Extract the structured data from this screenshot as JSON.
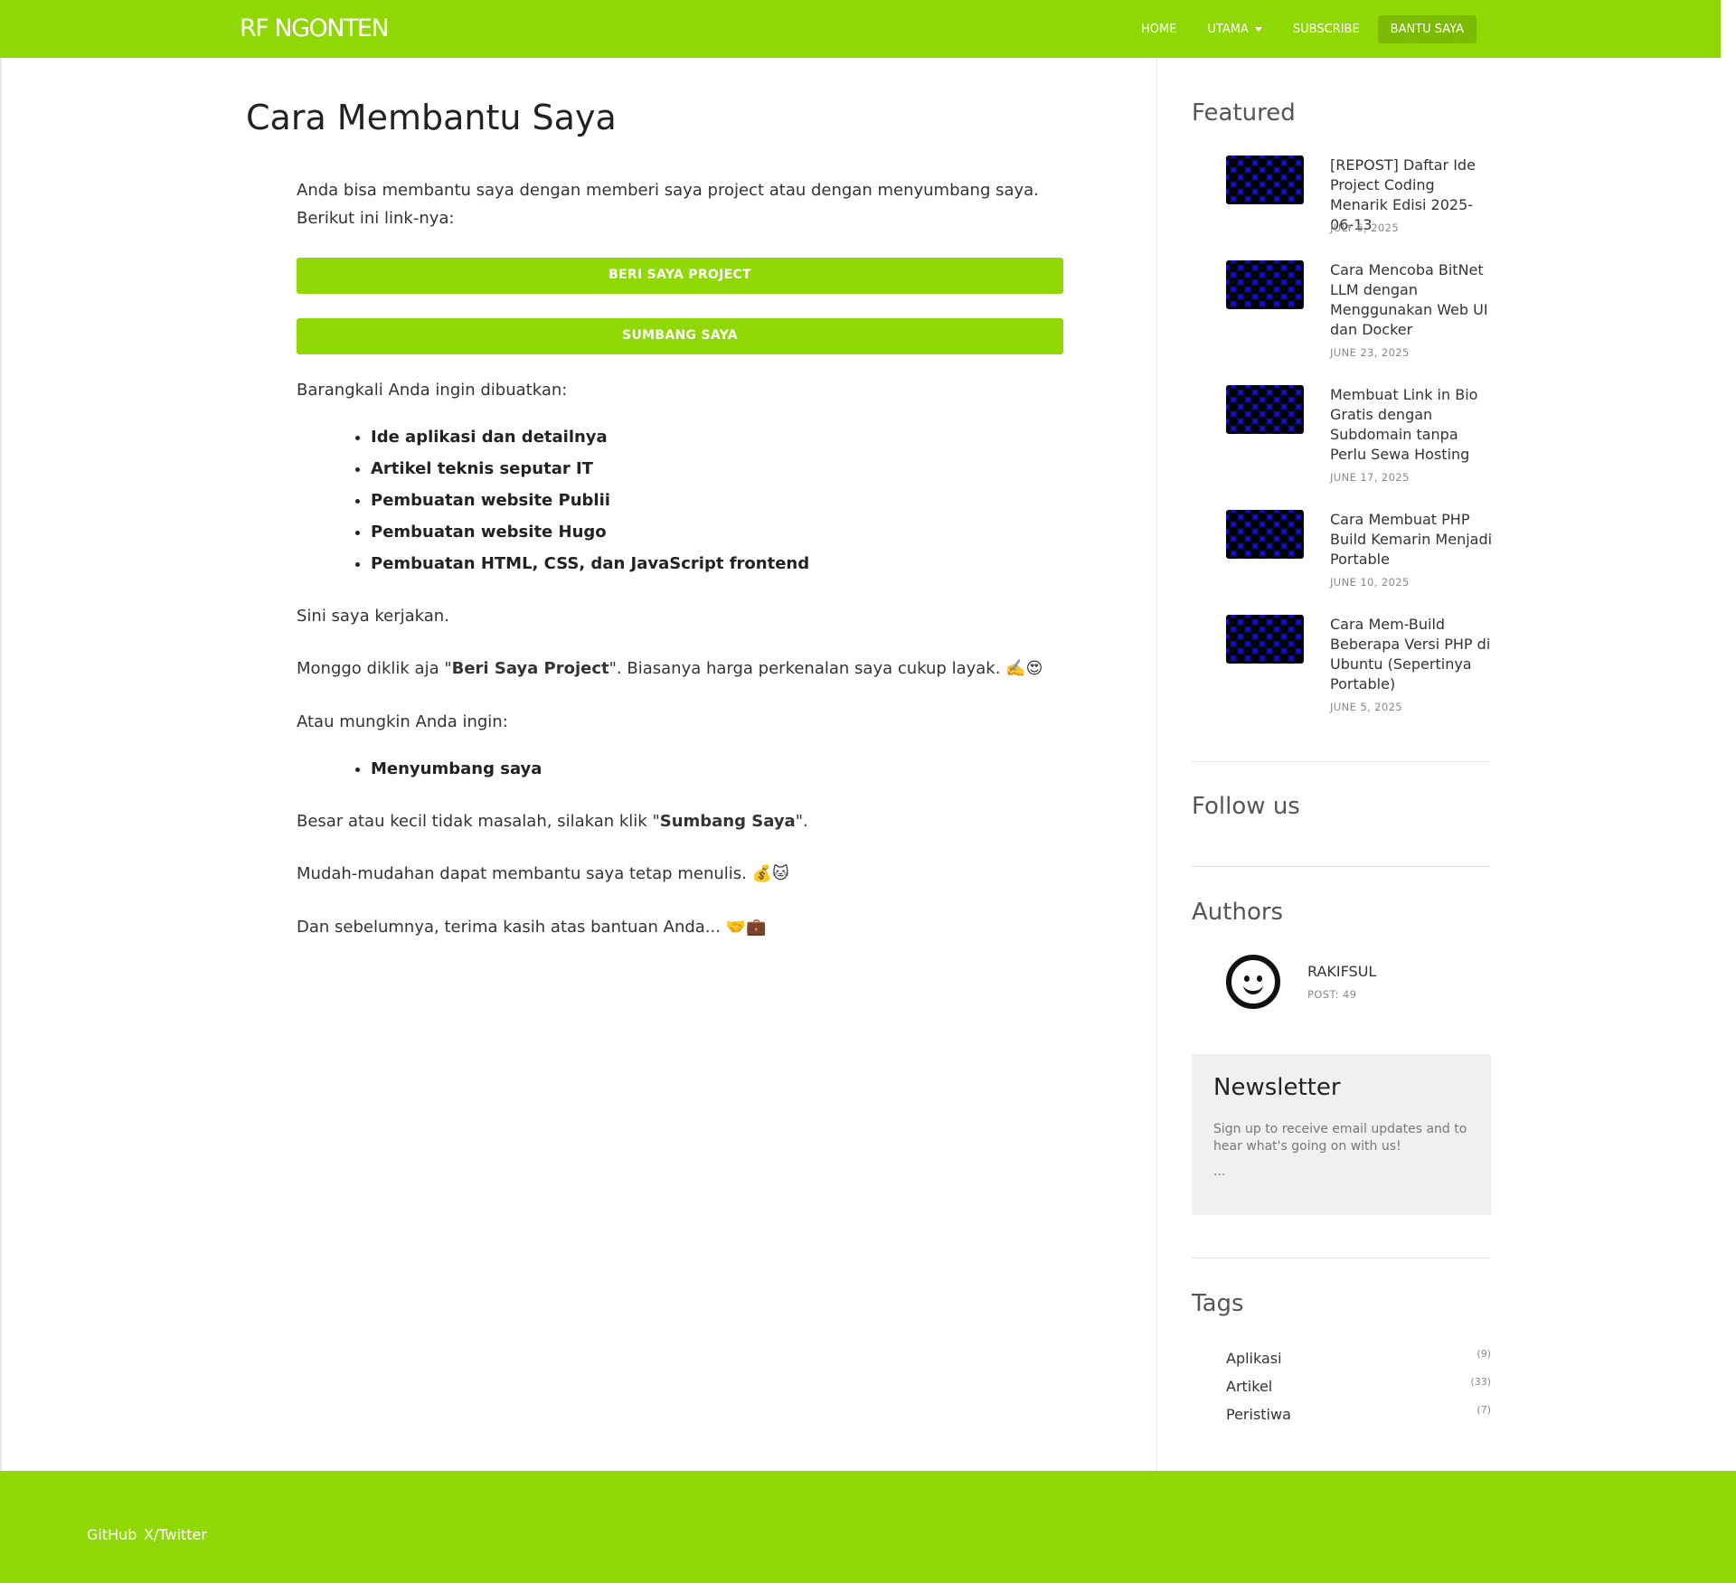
{
  "header": {
    "logo": "RF NGONTEN",
    "nav": {
      "home": "HOME",
      "utama": "UTAMA",
      "subscribe": "SUBSCRIBE",
      "bantu": "BANTU SAYA"
    }
  },
  "main": {
    "title": "Cara Membantu Saya",
    "intro": "Anda bisa membantu saya dengan memberi saya project atau dengan menyumbang saya. Berikut ini link-nya:",
    "button_project": "BERI SAYA PROJECT",
    "button_donate": "SUMBANG SAYA",
    "maybe_text": "Barangkali Anda ingin dibuatkan:",
    "services": [
      "Ide aplikasi dan detailnya",
      "Artikel teknis seputar IT",
      "Pembuatan website Publii",
      "Pembuatan website Hugo",
      "Pembuatan HTML, CSS, dan JavaScript frontend"
    ],
    "do_it": "Sini saya kerjakan.",
    "click_pre": "Monggo diklik aja \"",
    "click_bold": "Beri Saya Project",
    "click_post": "\". Biasanya harga perkenalan saya cukup layak. ✍️😍",
    "or_text": "Atau mungkin Anda ingin:",
    "donate_item": "Menyumbang saya",
    "amount_pre": "Besar atau kecil tidak masalah, silakan klik \"",
    "amount_bold": "Sumbang Saya",
    "amount_post": "\".",
    "hope": "Mudah-mudahan dapat membantu saya tetap menulis. 💰🐱",
    "thanks": "Dan sebelumnya, terima kasih atas bantuan Anda... 🤝💼"
  },
  "sidebar": {
    "featured_heading": "Featured",
    "featured": [
      {
        "title": "[REPOST] Daftar Ide Project Coding Menarik Edisi 2025-06-13",
        "date": "JULY 6, 2025"
      },
      {
        "title": "Cara Mencoba BitNet LLM dengan Menggunakan Web UI dan Docker",
        "date": "JUNE 23, 2025"
      },
      {
        "title": "Membuat Link in Bio Gratis dengan Subdomain tanpa Perlu Sewa Hosting",
        "date": "JUNE 17, 2025"
      },
      {
        "title": "Cara Membuat PHP Build Kemarin Menjadi Portable",
        "date": "JUNE 10, 2025"
      },
      {
        "title": "Cara Mem-Build Beberapa Versi PHP di Ubuntu (Sepertinya Portable)",
        "date": "JUNE 5, 2025"
      }
    ],
    "follow_heading": "Follow us",
    "authors_heading": "Authors",
    "author": {
      "name": "RAKIFSUL",
      "posts": "POST: 49"
    },
    "newsletter": {
      "heading": "Newsletter",
      "text": "Sign up to receive email updates and to hear what's going on with us!",
      "dots": "..."
    },
    "tags_heading": "Tags",
    "tags": [
      {
        "name": "Aplikasi",
        "count": "(9)"
      },
      {
        "name": "Artikel",
        "count": "(33)"
      },
      {
        "name": "Peristiwa",
        "count": "(7)"
      }
    ]
  },
  "footer": {
    "github": "GitHub",
    "twitter": "X/Twitter"
  },
  "colors": {
    "brand_green": "#8fd806",
    "active_nav": "#7cbb05",
    "thumb_blue": "#1010e6"
  }
}
